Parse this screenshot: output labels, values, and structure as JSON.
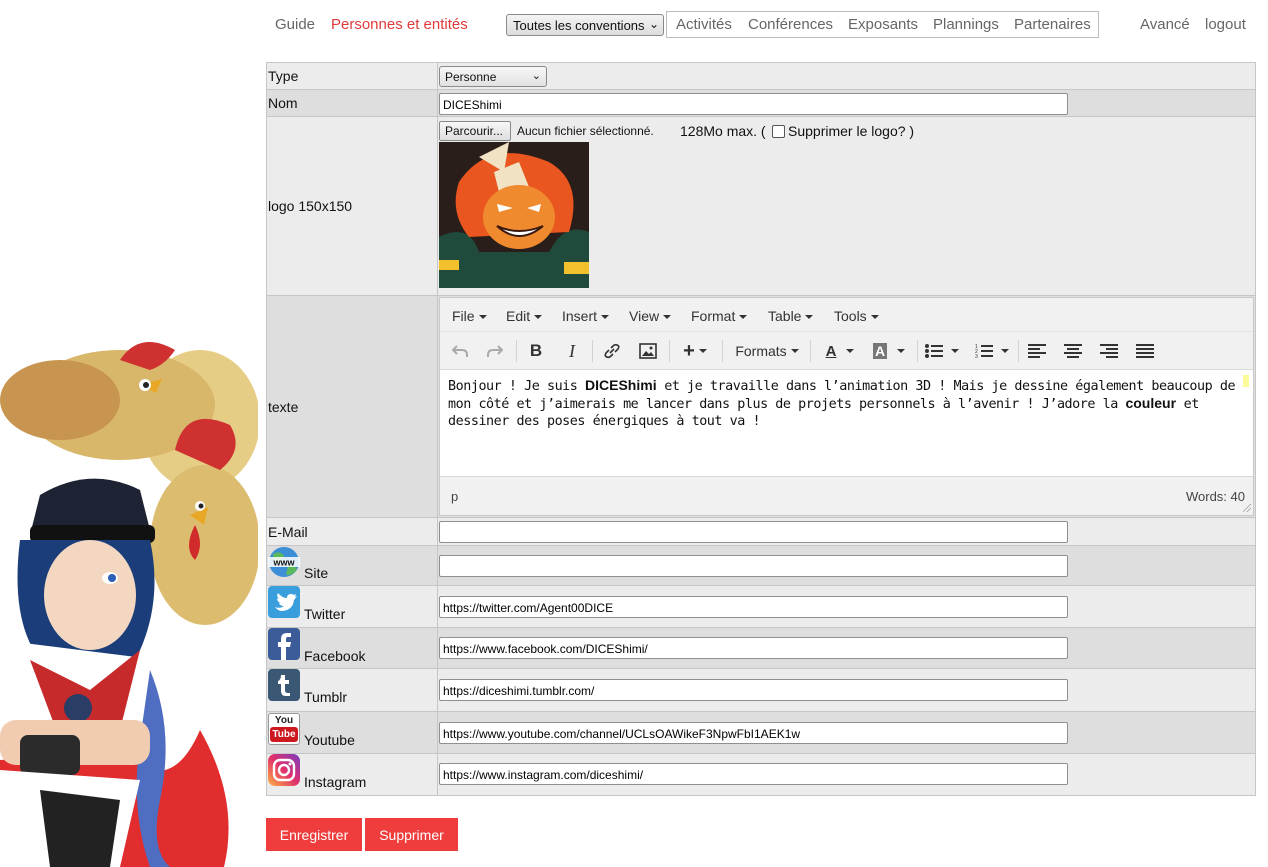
{
  "nav": {
    "guide": "Guide",
    "persons": "Personnes et entités",
    "conventions_select": "Toutes les conventions",
    "activities": "Activités",
    "conferences": "Conférences",
    "exhibitors": "Exposants",
    "plannings": "Plannings",
    "partners": "Partenaires",
    "advanced": "Avancé",
    "logout": "logout"
  },
  "form": {
    "type": {
      "label": "Type",
      "value": "Personne"
    },
    "name": {
      "label": "Nom",
      "value": "DICEShimi"
    },
    "logo": {
      "label": "logo 150x150",
      "browse": "Parcourir...",
      "no_file": "Aucun fichier sélectionné.",
      "max": "128Mo max. (",
      "delete_label": "Supprimer le logo? )"
    },
    "text": {
      "label": "texte",
      "menu": [
        "File",
        "Edit",
        "Insert",
        "View",
        "Format",
        "Table",
        "Tools"
      ],
      "formats": "Formats",
      "content": {
        "p1": "Bonjour ! Je suis ",
        "b1": "DICEShimi",
        "p2": " et je travaille dans l’animation 3D ! Mais je dessine également beaucoup de mon côté et j’aimerais me lancer dans plus de projets personnels à l’avenir ! J’adore la ",
        "b2": "couleur",
        "p3": " et dessiner des poses énergiques à tout va !"
      },
      "path": "p",
      "words": "Words: 40"
    },
    "email": {
      "label": "E-Mail",
      "value": ""
    },
    "site": {
      "label": "Site",
      "value": "",
      "icon": "www-globe-icon"
    },
    "twitter": {
      "label": "Twitter",
      "value": "https://twitter.com/Agent00DICE",
      "icon": "twitter-icon"
    },
    "facebook": {
      "label": "Facebook",
      "value": "https://www.facebook.com/DICEShimi/",
      "icon": "facebook-icon"
    },
    "tumblr": {
      "label": "Tumblr",
      "value": "https://diceshimi.tumblr.com/",
      "icon": "tumblr-icon"
    },
    "youtube": {
      "label": "Youtube",
      "value": "https://www.youtube.com/channel/UCLsOAWikeF3NpwFbI1AEK1w",
      "icon": "youtube-icon",
      "icon_text_top": "You",
      "icon_text_bottom": "Tube"
    },
    "instagram": {
      "label": "Instagram",
      "value": "https://www.instagram.com/diceshimi/",
      "icon": "instagram-icon"
    }
  },
  "buttons": {
    "save": "Enregistrer",
    "delete": "Supprimer"
  },
  "colors": {
    "accent": "#ef3d3d",
    "nav_active": "#e03a3a",
    "row_light": "#ececec",
    "row_dark": "#dedede"
  }
}
